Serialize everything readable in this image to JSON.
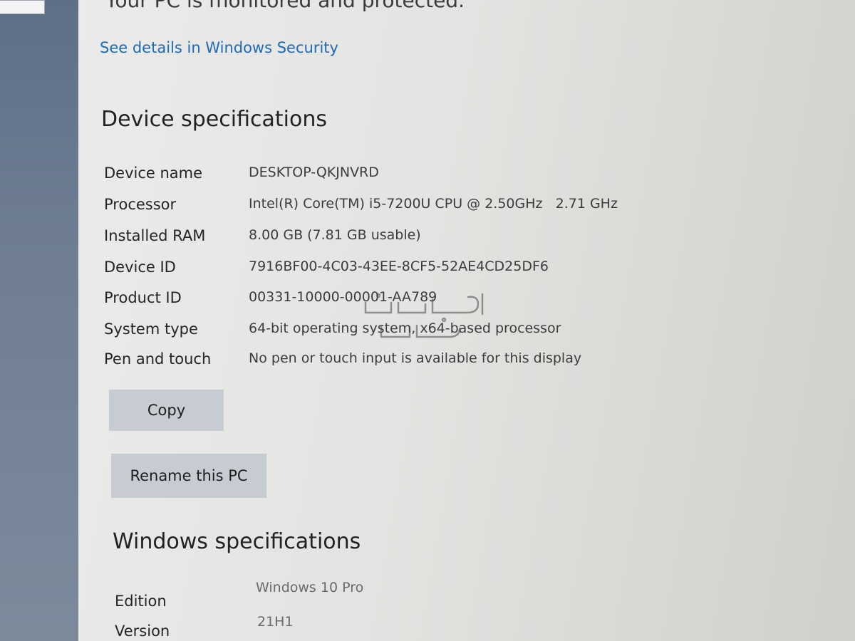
{
  "header": {
    "protected_text": "Your PC is monitored and protected.",
    "security_link": "See details in Windows Security"
  },
  "device_specs": {
    "title": "Device specifications",
    "rows": [
      {
        "label": "Device name",
        "value": "DESKTOP-QKJNVRD"
      },
      {
        "label": "Processor",
        "value": "Intel(R) Core(TM) i5-7200U CPU @ 2.50GHz   2.71 GHz"
      },
      {
        "label": "Installed RAM",
        "value": "8.00 GB (7.81 GB usable)"
      },
      {
        "label": "Device ID",
        "value": "7916BF00-4C03-43EE-8CF5-52AE4CD25DF6"
      },
      {
        "label": "Product ID",
        "value": "00331-10000-00001-AA789"
      },
      {
        "label": "System type",
        "value": "64-bit operating system, x64-based processor"
      },
      {
        "label": "Pen and touch",
        "value": "No pen or touch input is available for this display"
      }
    ],
    "copy_label": "Copy",
    "rename_label": "Rename this PC"
  },
  "windows_specs": {
    "title": "Windows specifications",
    "rows": [
      {
        "label": "Edition",
        "value": "Windows 10 Pro"
      },
      {
        "label": "Version",
        "value": "21H1"
      }
    ]
  },
  "colors": {
    "link": "#1f6bb3",
    "button_bg": "#c7ccd3",
    "sidebar": "#6f7e93"
  }
}
